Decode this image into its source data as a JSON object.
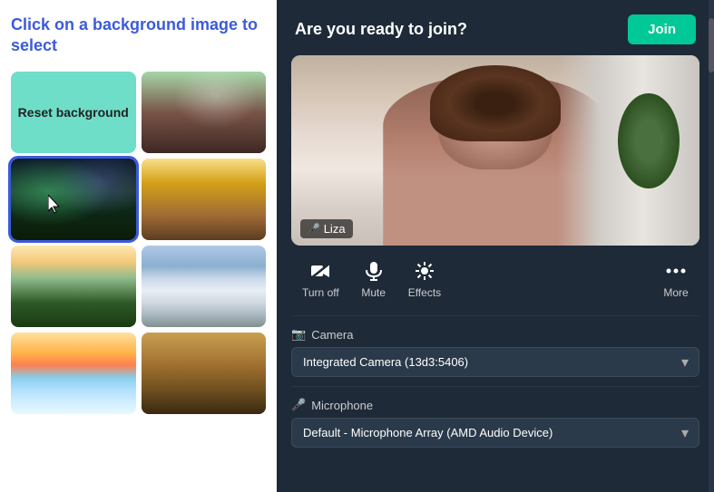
{
  "left": {
    "instruction": "Click on a background image to select",
    "backgrounds": [
      {
        "id": "reset",
        "label": "Reset background",
        "type": "reset"
      },
      {
        "id": "cafe",
        "label": "Cafe background",
        "type": "cafe"
      },
      {
        "id": "aurora",
        "label": "Aurora background",
        "type": "aurora",
        "selected": true
      },
      {
        "id": "chairs",
        "label": "Chairs background",
        "type": "chairs"
      },
      {
        "id": "forest",
        "label": "Forest background",
        "type": "forest"
      },
      {
        "id": "mountains",
        "label": "Mountains background",
        "type": "mountains"
      },
      {
        "id": "sunset",
        "label": "Sunset background",
        "type": "sunset"
      },
      {
        "id": "resort",
        "label": "Resort background",
        "type": "resort"
      }
    ]
  },
  "right": {
    "header": {
      "ready_text": "Are you ready to join?",
      "join_button": "Join"
    },
    "video": {
      "user_name": "Liza",
      "mic_icon": "🎤"
    },
    "controls": [
      {
        "id": "turn-off",
        "label": "Turn off",
        "icon": "video_off"
      },
      {
        "id": "mute",
        "label": "Mute",
        "icon": "mic"
      },
      {
        "id": "effects",
        "label": "Effects",
        "icon": "effects"
      },
      {
        "id": "more",
        "label": "More",
        "icon": "more"
      }
    ],
    "camera": {
      "label": "Camera",
      "icon": "📷",
      "options": [
        "Integrated Camera (13d3:5406)"
      ],
      "selected": "Integrated Camera (13d3:5406)"
    },
    "microphone": {
      "label": "Microphone",
      "icon": "🎤",
      "options": [
        "Default - Microphone Array (AMD Audio Device)"
      ],
      "selected": "Default - Microphone Array (AMD Audio Device)"
    }
  }
}
